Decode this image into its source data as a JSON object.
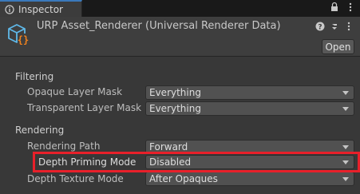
{
  "tab": {
    "label": "Inspector",
    "icon": "info-icon"
  },
  "tab_actions": {
    "lock_icon": "lock-icon",
    "menu_icon": "kebab-menu-icon"
  },
  "header": {
    "title": "URP Asset_Renderer (Universal Renderer Data)",
    "icon": "scriptable-object-icon",
    "help_icon": "help-icon",
    "settings_icon": "settings-icon",
    "menu_icon": "kebab-menu-icon",
    "open_label": "Open"
  },
  "sections": [
    {
      "title": "Filtering",
      "properties": [
        {
          "label": "Opaque Layer Mask",
          "value": "Everything"
        },
        {
          "label": "Transparent Layer Mask",
          "value": "Everything"
        }
      ]
    },
    {
      "title": "Rendering",
      "properties": [
        {
          "label": "Rendering Path",
          "value": "Forward"
        },
        {
          "label": "Depth Priming Mode",
          "value": "Disabled"
        },
        {
          "label": "Depth Texture Mode",
          "value": "After Opaques"
        }
      ]
    }
  ],
  "colors": {
    "highlight": "#e8202a",
    "tab_accent": "#3a79bb",
    "icon_accent": "#f0821e",
    "icon_cube": "#5fb8e8"
  }
}
